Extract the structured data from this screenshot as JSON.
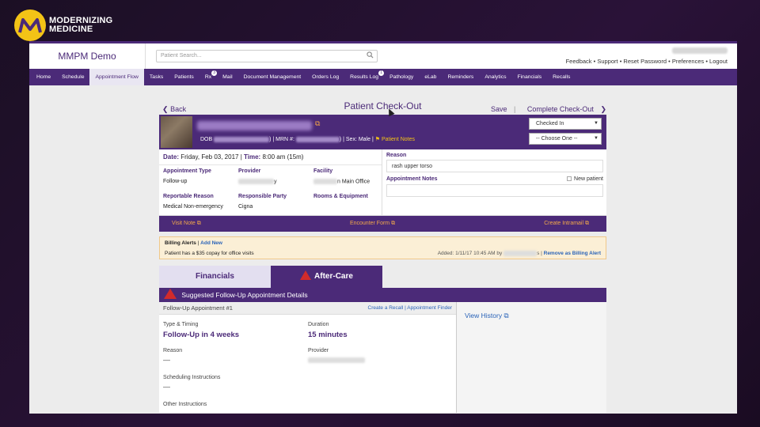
{
  "brand": {
    "line1": "MODERNIZING",
    "line2": "MEDICINE",
    "colors": {
      "yellow": "#f3c316",
      "purple": "#4b2a78"
    }
  },
  "header": {
    "app_title": "MMPM Demo",
    "search_placeholder": "Patient Search...",
    "links": [
      "Feedback",
      "Support",
      "Reset Password",
      "Preferences",
      "Logout"
    ]
  },
  "nav": {
    "items": [
      {
        "label": "Home"
      },
      {
        "label": "Schedule"
      },
      {
        "label": "Appointment Flow",
        "active": true
      },
      {
        "label": "Tasks"
      },
      {
        "label": "Patients"
      },
      {
        "label": "Rx",
        "badge": "3"
      },
      {
        "label": "Mail"
      },
      {
        "label": "Document Management"
      },
      {
        "label": "Orders Log"
      },
      {
        "label": "Results Log",
        "badge": "1"
      },
      {
        "label": "Pathology"
      },
      {
        "label": "eLab"
      },
      {
        "label": "Reminders"
      },
      {
        "label": "Analytics"
      },
      {
        "label": "Financials"
      },
      {
        "label": "Recalls"
      }
    ]
  },
  "page": {
    "back": "Back",
    "title": "Patient Check-Out",
    "save": "Save",
    "separator": "|",
    "complete": "Complete Check-Out"
  },
  "patient": {
    "dob_label": "DOB",
    "mrn_label": ") | MRN #:",
    "sex": ") | Sex: Male |",
    "notes": "Patient Notes",
    "status": "Checked In",
    "choose": "-- Choose One --"
  },
  "appointment": {
    "date_label": "Date:",
    "date": "Friday, Feb 03, 2017",
    "time_label": "Time:",
    "time": "8:00 am (15m)",
    "type_label": "Appointment Type",
    "type": "Follow-up",
    "provider_label": "Provider",
    "provider_suffix": "y",
    "facility_label": "Facility",
    "facility": "n Main Office",
    "reportable_label": "Reportable Reason",
    "reportable": "Medical Non-emergency",
    "party_label": "Responsible Party",
    "party": "Cigna",
    "rooms_label": "Rooms & Equipment",
    "reason_label": "Reason",
    "reason": "rash upper torso",
    "notes_label": "Appointment Notes",
    "new_patient": "New patient"
  },
  "links": {
    "visit": "Visit Note",
    "encounter": "Encounter Form",
    "intramail": "Create Intramail"
  },
  "billing": {
    "title": "Billing Alerts",
    "add": "Add New",
    "message": "Patient has a $35 copay for office visits",
    "added": "Added: 1/11/17 10:45 AM by",
    "added_tail": "s |",
    "remove": "Remove as Billing Alert"
  },
  "tabs": {
    "financials": "Financials",
    "aftercare": "After-Care"
  },
  "followup": {
    "banner": "Suggested Follow-Up Appointment Details",
    "heading": "Follow-Up Appointment #1",
    "create_recall": "Create a Recall",
    "finder": "Appointment Finder",
    "type_label": "Type & Timing",
    "type_value": "Follow-Up in 4 weeks",
    "duration_label": "Duration",
    "duration_value": "15 minutes",
    "reason_label": "Reason",
    "reason_value": "—",
    "provider_label": "Provider",
    "sched_label": "Scheduling Instructions",
    "sched_value": "—",
    "other_label": "Other Instructions",
    "history": "View History"
  }
}
